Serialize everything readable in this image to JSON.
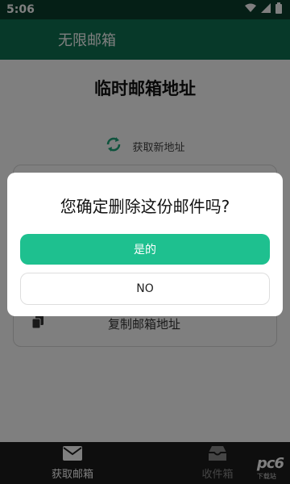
{
  "status_bar": {
    "time": "5:06",
    "icons": [
      "wifi-icon",
      "signal-icon",
      "battery-icon"
    ]
  },
  "app_bar": {
    "title": "无限邮箱"
  },
  "main": {
    "heading": "临时邮箱地址",
    "refresh_label": "获取新地址",
    "copy_label": "复制邮箱地址"
  },
  "dialog": {
    "message": "您确定删除这份邮件吗?",
    "yes_label": "是的",
    "no_label": "NO"
  },
  "bottom_nav": {
    "tabs": [
      {
        "label": "获取邮箱",
        "icon": "mail-icon",
        "active": true
      },
      {
        "label": "收件箱",
        "icon": "inbox-icon",
        "active": false
      }
    ]
  },
  "watermark": {
    "brand": "pc6",
    "sub": "下载站"
  },
  "colors": {
    "status_bar": "#0b3f2d",
    "app_bar": "#0f7352",
    "accent": "#1ec08f",
    "nav_bg": "#1c1c1c"
  }
}
